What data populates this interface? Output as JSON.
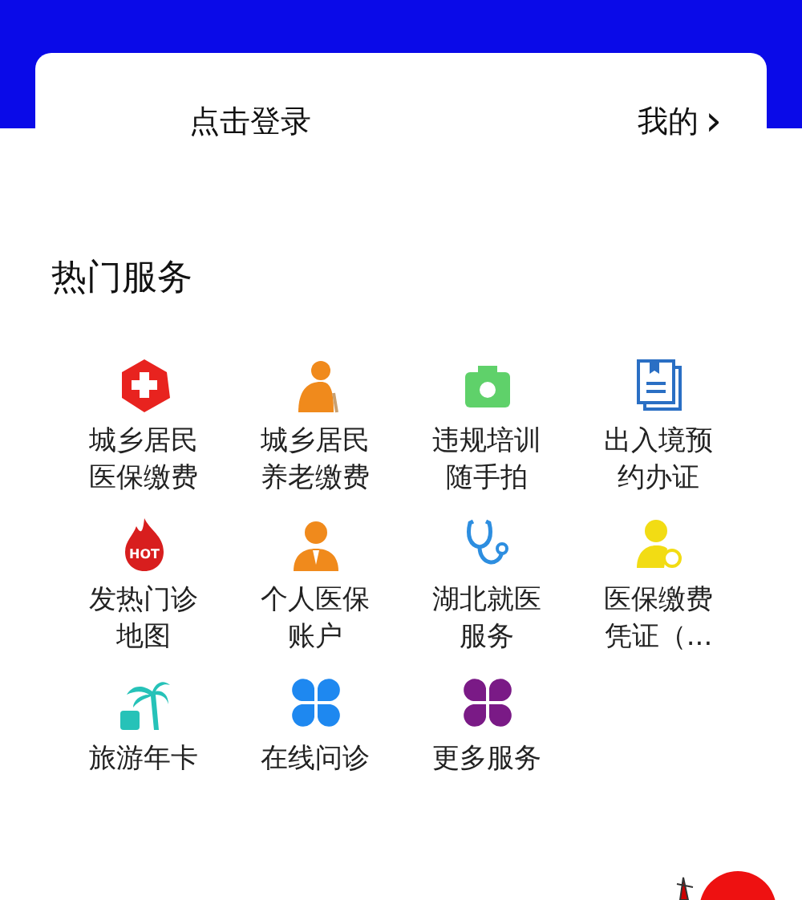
{
  "login_card": {
    "login_link": "点击登录",
    "mine_link": "我的",
    "mine_arrow": "›"
  },
  "hot_services": {
    "title": "热门服务",
    "items": [
      {
        "kind": "cross",
        "label": "城乡居民医保缴费",
        "color": "#e8231f"
      },
      {
        "kind": "elder",
        "label": "城乡居民养老缴费",
        "color": "#f08a1c"
      },
      {
        "kind": "camera",
        "label": "违规培训随手拍",
        "color": "#5fd16a"
      },
      {
        "kind": "document",
        "label": "出入境预约办证",
        "color": "#2a6fc4"
      },
      {
        "kind": "hot",
        "label": "发热门诊地图",
        "color": "#d81e1e",
        "icon_text": "HOT"
      },
      {
        "kind": "person",
        "label": "个人医保账户",
        "color": "#f08a1c"
      },
      {
        "kind": "stethoscope",
        "label": "湖北就医服务",
        "color": "#2d8ee0"
      },
      {
        "kind": "user-search",
        "label": "医保缴费凭证（...",
        "color": "#f2dc14"
      },
      {
        "kind": "palm",
        "label": "旅游年卡",
        "color": "#26c2b8"
      },
      {
        "kind": "clover",
        "label": "在线问诊",
        "color": "#1e88f0"
      },
      {
        "kind": "clover",
        "label": "更多服务",
        "color": "#7a1a86"
      }
    ]
  }
}
